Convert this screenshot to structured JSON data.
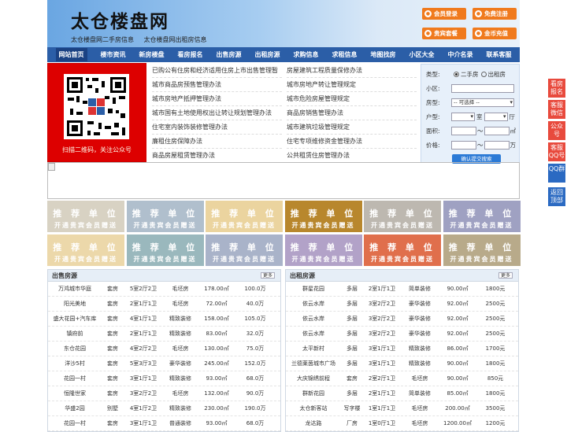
{
  "header": {
    "title": "太仓楼盘网",
    "sub_links": [
      "太仓楼盘网二手房信息",
      "太仓楼盘网出租房信息"
    ],
    "buttons": [
      {
        "label": "会员登录",
        "icon": "user-icon"
      },
      {
        "label": "免费注册",
        "icon": "register-icon"
      },
      {
        "label": "贵宾套餐",
        "icon": "vip-icon"
      },
      {
        "label": "金币充值",
        "icon": "coin-icon"
      }
    ]
  },
  "nav": [
    "网站首页",
    "楼市资讯",
    "新房楼盘",
    "看房报名",
    "出售房源",
    "出租房源",
    "求购信息",
    "求租信息",
    "地图找房",
    "小区大全",
    "中介名录",
    "联系客服"
  ],
  "qr": {
    "caption": "扫描二维码，关注公众号"
  },
  "links_left": [
    "已购公有住房和经济适用住房上市出售管理暂",
    "城市商品房预售管理办法",
    "城市房地产抵押管理办法",
    "城市国有土地使用权出让转让规划管理办法",
    "住宅室内装饰装修管理办法",
    "廉租住房保障办法",
    "商品房屋租赁管理办法"
  ],
  "links_right": [
    "房屋建筑工程质量保修办法",
    "城市房地产转让管理规定",
    "城市危险房屋管理规定",
    "商品房销售管理办法",
    "城市建筑垃圾管理规定",
    "住宅专项维修资金管理办法",
    "公共租赁住房管理办法"
  ],
  "search": {
    "type_label": "类型:",
    "opt1": "二手房",
    "opt2": "出租房",
    "community_label": "小区:",
    "style_label": "房型:",
    "style_value": "-- 可选择 --",
    "layout_label": "户型:",
    "room_unit": "室",
    "hall_unit": "厅",
    "area_label": "面积:",
    "to": "～",
    "area_unit": "㎡",
    "price_label": "价格:",
    "price_unit": "万",
    "submit": "确认提交搜索"
  },
  "ads": {
    "title": "推 荐 单 位",
    "subtitle": "开通贵宾会员赠送"
  },
  "ad_colors": [
    "#d8d2c3",
    "#b0bfcd",
    "#ebd49f",
    "#b8872d",
    "#bdb8b0",
    "#9fa1c2",
    "#ecd8aa",
    "#9ab8bd",
    "#a9b3c9",
    "#b2a2c8",
    "#e06f4c",
    "#b8aa8a"
  ],
  "sale": {
    "title": "出售房源",
    "more": "更多",
    "rows": [
      [
        "万鸿城市华庭",
        "套房",
        "5室2厅2卫",
        "毛坯房",
        "178.00㎡",
        "100.0万"
      ],
      [
        "阳光美地",
        "套房",
        "2室1厅1卫",
        "毛坯房",
        "72.00㎡",
        "40.0万"
      ],
      [
        "盛大花园+汽车库",
        "套房",
        "4室1厅1卫",
        "精致装修",
        "158.00㎡",
        "105.0万"
      ],
      [
        "镇府前",
        "套房",
        "2室1厅1卫",
        "精致装修",
        "83.00㎡",
        "32.0万"
      ],
      [
        "东仓花园",
        "套房",
        "4室2厅2卫",
        "毛坯房",
        "130.00㎡",
        "75.0万"
      ],
      [
        "洋沙5村",
        "套房",
        "5室3厅3卫",
        "豪华装修",
        "245.00㎡",
        "152.0万"
      ],
      [
        "花园一村",
        "套房",
        "3室1厅1卫",
        "精致装修",
        "93.00㎡",
        "68.0万"
      ],
      [
        "恒隆世家",
        "套房",
        "3室2厅2卫",
        "毛坯房",
        "132.00㎡",
        "90.0万"
      ],
      [
        "华盛2园",
        "别墅",
        "4室1厅2卫",
        "精致装修",
        "230.00㎡",
        "190.0万"
      ],
      [
        "花园一村",
        "套房",
        "3室1厅1卫",
        "普通装修",
        "93.00㎡",
        "68.0万"
      ]
    ]
  },
  "rent": {
    "title": "出租房源",
    "more": "更多",
    "rows": [
      [
        "群星花园",
        "多层",
        "2室1厅1卫",
        "简单装修",
        "90.00㎡",
        "1800元"
      ],
      [
        "依云水岸",
        "多层",
        "3室2厅2卫",
        "豪华装修",
        "92.00㎡",
        "2500元"
      ],
      [
        "依云水岸",
        "多层",
        "3室2厅2卫",
        "豪华装修",
        "92.00㎡",
        "2500元"
      ],
      [
        "依云水岸",
        "多层",
        "3室2厅2卫",
        "豪华装修",
        "92.00㎡",
        "2500元"
      ],
      [
        "太平新村",
        "多层",
        "3室1厅1卫",
        "精致装修",
        "86.00㎡",
        "1700元"
      ],
      [
        "兰德莱茵城市广场",
        "多层",
        "3室1厅1卫",
        "精致装修",
        "90.00㎡",
        "1800元"
      ],
      [
        "大庆锦绣前程",
        "套房",
        "2室2厅1卫",
        "毛坯房",
        "90.00㎡",
        "850元"
      ],
      [
        "群新花园",
        "多层",
        "2室1厅1卫",
        "简单装修",
        "85.00㎡",
        "1800元"
      ],
      [
        "太仓新客站",
        "写字楼",
        "1室1厅1卫",
        "毛坯房",
        "200.00㎡",
        "3500元"
      ],
      [
        "龙达路",
        "厂房",
        "1室0厅1卫",
        "毛坯房",
        "1200.00㎡",
        "1200元"
      ]
    ]
  },
  "side": [
    "看房报名",
    "客服微信",
    "公众号",
    "客服QQ号",
    "QQ群",
    "返回顶部"
  ]
}
